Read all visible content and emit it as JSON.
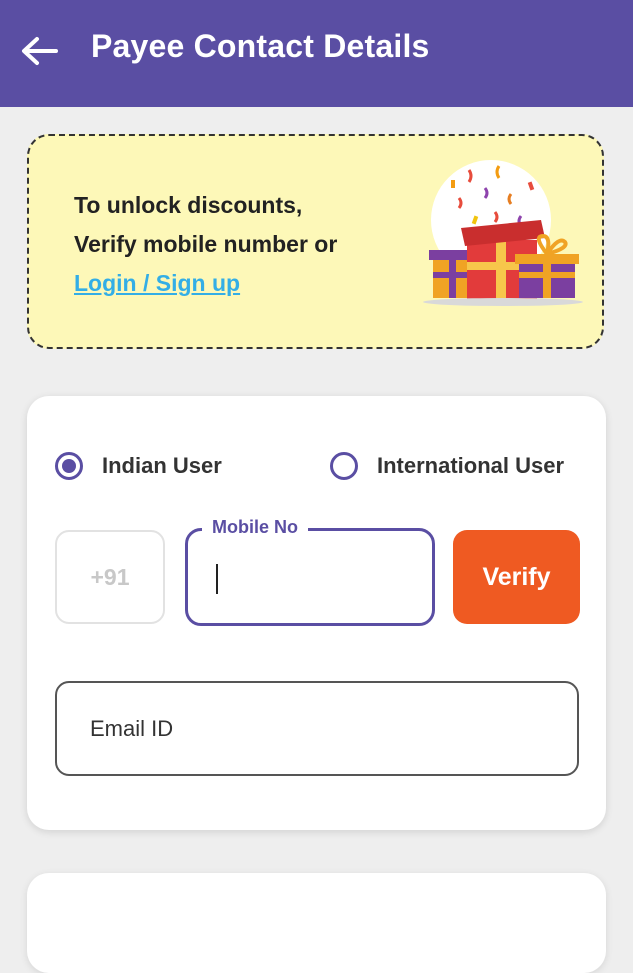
{
  "header": {
    "title": "Payee Contact Details",
    "back_icon": "arrow-left-icon",
    "color": "#5a4ea3"
  },
  "promo": {
    "line1": "To unlock discounts,",
    "line2": "Verify mobile number or",
    "link": "Login / Sign up",
    "illustration": "gift-boxes-icon",
    "background": "#fdf8b8"
  },
  "user_type": {
    "options": [
      {
        "label": "Indian User",
        "selected": true
      },
      {
        "label": "International User",
        "selected": false
      }
    ]
  },
  "phone": {
    "country_code": "+91",
    "label": "Mobile No",
    "value": "",
    "verify_label": "Verify",
    "verify_color": "#ef5a22"
  },
  "email": {
    "placeholder": "Email ID",
    "value": ""
  }
}
